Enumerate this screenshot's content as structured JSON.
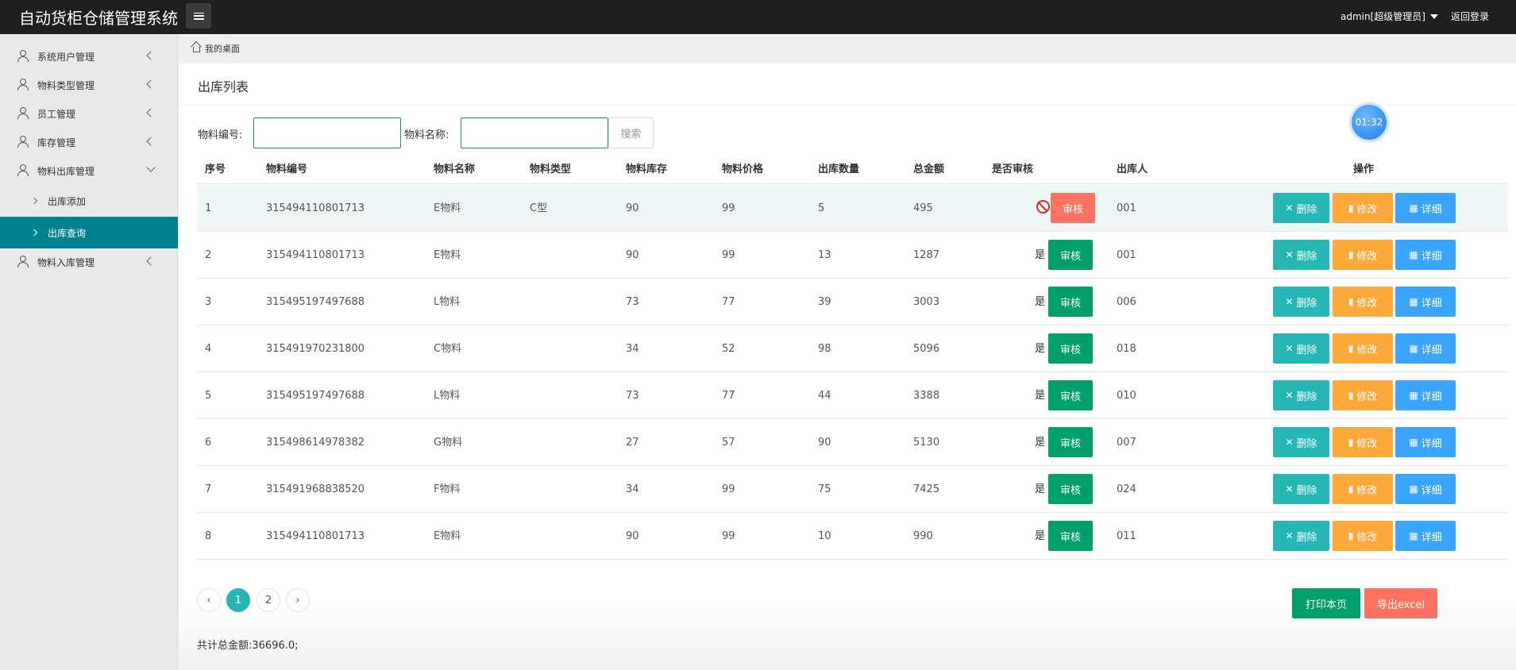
{
  "app": {
    "title": "自动货柜仓储管理系统"
  },
  "header": {
    "user": "admin[超级管理员]",
    "logout": "返回登录"
  },
  "sidebar": {
    "items": [
      {
        "label": "系统用户管理",
        "expanded": false
      },
      {
        "label": "物料类型管理",
        "expanded": false
      },
      {
        "label": "员工管理",
        "expanded": false
      },
      {
        "label": "库存管理",
        "expanded": false
      },
      {
        "label": "物料出库管理",
        "expanded": true
      },
      {
        "label": "物料入库管理",
        "expanded": false
      }
    ],
    "subitems": [
      {
        "label": "出库添加",
        "active": false
      },
      {
        "label": "出库查询",
        "active": true
      }
    ]
  },
  "breadcrumb": {
    "label": "我的桌面"
  },
  "page": {
    "title": "出库列表"
  },
  "filters": {
    "code_label": "物料编号:",
    "code_value": "",
    "name_label": "物料名称:",
    "name_value": "",
    "search_label": "搜索"
  },
  "timer": "01:32",
  "table": {
    "headers": [
      "序号",
      "物料编号",
      "物料名称",
      "物料类型",
      "物料库存",
      "物料价格",
      "出库数量",
      "总金额",
      "是否审核",
      "出库人",
      "操作"
    ],
    "rows": [
      {
        "no": "1",
        "code": "315494110801713",
        "name": "E物料",
        "type": "C型",
        "stock": "90",
        "price": "99",
        "qty": "5",
        "total": "495",
        "audited": "",
        "operator": "001"
      },
      {
        "no": "2",
        "code": "315494110801713",
        "name": "E物料",
        "type": "",
        "stock": "90",
        "price": "99",
        "qty": "13",
        "total": "1287",
        "audited": "是",
        "operator": "001"
      },
      {
        "no": "3",
        "code": "315495197497688",
        "name": "L物料",
        "type": "",
        "stock": "73",
        "price": "77",
        "qty": "39",
        "total": "3003",
        "audited": "是",
        "operator": "006"
      },
      {
        "no": "4",
        "code": "315491970231800",
        "name": "C物料",
        "type": "",
        "stock": "34",
        "price": "52",
        "qty": "98",
        "total": "5096",
        "audited": "是",
        "operator": "018"
      },
      {
        "no": "5",
        "code": "315495197497688",
        "name": "L物料",
        "type": "",
        "stock": "73",
        "price": "77",
        "qty": "44",
        "total": "3388",
        "audited": "是",
        "operator": "010"
      },
      {
        "no": "6",
        "code": "315498614978382",
        "name": "G物料",
        "type": "",
        "stock": "27",
        "price": "57",
        "qty": "90",
        "total": "5130",
        "audited": "是",
        "operator": "007"
      },
      {
        "no": "7",
        "code": "315491968838520",
        "name": "F物料",
        "type": "",
        "stock": "34",
        "price": "99",
        "qty": "75",
        "total": "7425",
        "audited": "是",
        "operator": "024"
      },
      {
        "no": "8",
        "code": "315494110801713",
        "name": "E物料",
        "type": "",
        "stock": "90",
        "price": "99",
        "qty": "10",
        "total": "990",
        "audited": "是",
        "operator": "011"
      }
    ],
    "actions": {
      "audit": "审核",
      "delete": "删除",
      "edit": "修改",
      "detail": "详细"
    }
  },
  "pagination": {
    "prev": "‹",
    "pages": [
      "1",
      "2"
    ],
    "current": "1",
    "next": "›"
  },
  "footer": {
    "print": "打印本页",
    "export": "导出excel",
    "total": "共计总金额:36696.0;"
  },
  "colors": {
    "topbar": "#1f1f1f",
    "accent": "#00838f",
    "audit_green": "#009f6b",
    "audit_red": "#ff7260",
    "delete": "#26b7b5",
    "edit": "#ffa93a",
    "detail": "#3aa5ff"
  }
}
